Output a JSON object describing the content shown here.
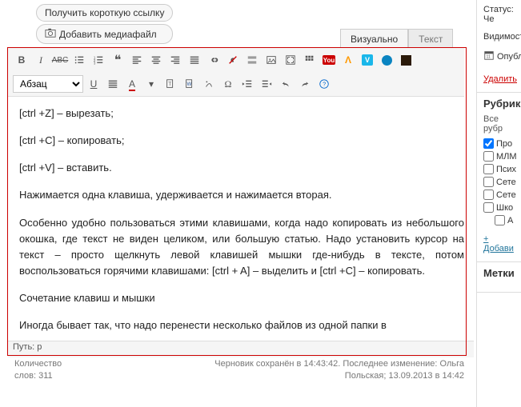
{
  "buttons": {
    "shortlink": "Получить короткую ссылку",
    "addmedia": "Добавить медиафайл"
  },
  "tabs": {
    "visual": "Визуально",
    "text": "Текст"
  },
  "format_select": "Абзац",
  "content": {
    "p1": "[ctrl +Z] – вырезать;",
    "p2": "[ctrl +C] – копировать;",
    "p3": "[ctrl +V] – вставить.",
    "p4": "Нажимается одна клавиша, удерживается и нажимается вторая.",
    "p5": "Особенно удобно пользоваться этими клавишами, когда надо копировать из небольшого окошка, где текст не виден целиком, или большую статью. Надо установить курсор на текст – просто щелкнуть левой клавишей мышки где-нибудь в тексте, потом воспользоваться горячими клавишами: [ctrl + A] – выделить и [ctrl +C] – копировать.",
    "p6": "Сочетание клавиш и мышки",
    "p7": "Иногда бывает так, что надо перенести несколько файлов из одной папки в"
  },
  "statusbar": "Путь: p",
  "footer": {
    "wc_label": "Количество",
    "wc_line2": "слов: 311",
    "saved": "Черновик сохранён в 14:43:42.",
    "mod": "Последнее изменение: Ольга",
    "mod2": "Польская; 13.09.2013 в 14:42"
  },
  "sidebar": {
    "status_lbl": "Статус:",
    "status_val": "Че",
    "visibility": "Видимост",
    "publish": "Опубл",
    "delete": "Удалить",
    "rubrics": "Рубрики",
    "allrub": "Все рубр",
    "cats": [
      "Про",
      "МЛМ",
      "Псих",
      "Сете",
      "Сете",
      "Шко"
    ],
    "cat_a": "А",
    "addcat": "+ Добави",
    "tags": "Метки"
  }
}
